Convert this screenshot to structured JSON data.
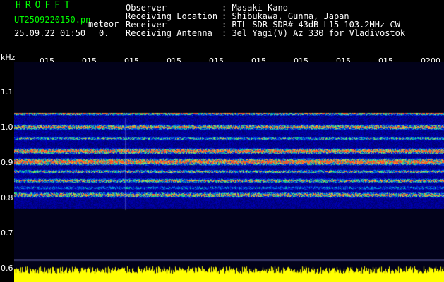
{
  "header": {
    "brand": "HROFFT",
    "file": "UT2509220150.pn",
    "mode": "meteor",
    "datetime": "25.09.22 01:50",
    "count": "0.",
    "observer_label": "Observer",
    "observer": ": Masaki Kano",
    "location_label": "Receiving Location",
    "location": ": Shibukawa, Gunma, Japan",
    "receiver_label": "Receiver",
    "receiver": ": RTL-SDR SDR# 43dB L15 103.2MHz CW",
    "antenna_label": "Receiving Antenna",
    "antenna": ": 3el Yagi(V) Az 330 for Vladivostok"
  },
  "axes": {
    "y_unit": "kHz",
    "y_ticks": [
      "1.1",
      "1.0",
      "0.9",
      "0.8",
      "0.7",
      "0.6"
    ],
    "x_ticks": [
      "015",
      "015",
      "015",
      "015",
      "015",
      "015",
      "015",
      "015",
      "015",
      "0200"
    ]
  },
  "colors": {
    "background": "#000000",
    "plot_background": "#02021a",
    "label_green": "#00ff00",
    "text_white": "#ffffff",
    "level_bar": "#ffff00"
  }
}
